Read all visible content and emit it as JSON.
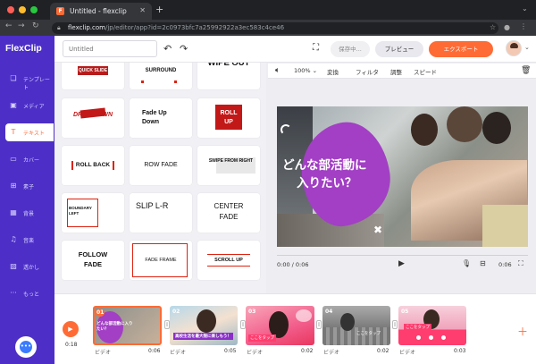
{
  "browser": {
    "tab_title": "Untitled - flexclip",
    "favicon_letter": "F",
    "url_host": "flexclip.com",
    "url_path": "/jp/editor/app?id=2c0973bfc7a25992922a3ec583c4ce46"
  },
  "app": {
    "logo": "FlexClip",
    "project_title_placeholder": "Untitled",
    "saving": "保存中...",
    "preview": "プレビュー",
    "export": "エクスポート"
  },
  "sidebar": {
    "items": [
      {
        "label": "テンプレート",
        "icon": "layers-icon"
      },
      {
        "label": "メディア",
        "icon": "media-icon"
      },
      {
        "label": "テキスト",
        "icon": "text-icon"
      },
      {
        "label": "カバー",
        "icon": "cover-icon"
      },
      {
        "label": "素子",
        "icon": "elements-icon"
      },
      {
        "label": "背景",
        "icon": "background-icon"
      },
      {
        "label": "音楽",
        "icon": "music-icon"
      },
      {
        "label": "透かし",
        "icon": "watermark-icon"
      },
      {
        "label": "もっと",
        "icon": "more-icon"
      }
    ],
    "active_index": 2
  },
  "templates": [
    {
      "label": "QUICK SLIDE"
    },
    {
      "label": "SURROUND"
    },
    {
      "label": "WIPE OUT"
    },
    {
      "label": "DROP DOWN"
    },
    {
      "label": "Fade Up Down"
    },
    {
      "label": "ROLL UP"
    },
    {
      "label": "ROLL BACK"
    },
    {
      "label": "ROW FADE"
    },
    {
      "label": "SWIPE FROM RIGHT"
    },
    {
      "label": "BOUNDARY LEFT"
    },
    {
      "label": "SLIP L-R"
    },
    {
      "label": "CENTER FADE"
    },
    {
      "label": "FOLLOW FADE"
    },
    {
      "label": "FADE FRAME"
    },
    {
      "label": "SCROLL UP"
    }
  ],
  "preview_toolbar": {
    "zoom": "100%",
    "transform": "変換",
    "filter": "フィルタ",
    "adjust": "調整",
    "speed": "スピード"
  },
  "stage": {
    "caption_line1": "どんな部活動に",
    "caption_line2": "入りたい？",
    "blob_color": "#a23fc4"
  },
  "playback": {
    "time": "0:00 / 0:06",
    "duration": "0:06"
  },
  "timeline": {
    "current_time": "0:18",
    "clips": [
      {
        "num": "01",
        "type": "ビデオ",
        "duration": "0:06",
        "caption": "どんな部活動に入りたい？"
      },
      {
        "num": "02",
        "type": "ビデオ",
        "duration": "0:05",
        "caption": "高校生活を最大限に楽しもう！"
      },
      {
        "num": "03",
        "type": "ビデオ",
        "duration": "0:02",
        "caption": "ここをタップ"
      },
      {
        "num": "04",
        "type": "ビデオ",
        "duration": "0:02",
        "caption": "ここをタップ"
      },
      {
        "num": "05",
        "type": "ビデオ",
        "duration": "0:03",
        "caption": "ここをタップ"
      }
    ]
  },
  "colors": {
    "accent": "#ff6b35",
    "sidebar": "#4d2fc7"
  }
}
